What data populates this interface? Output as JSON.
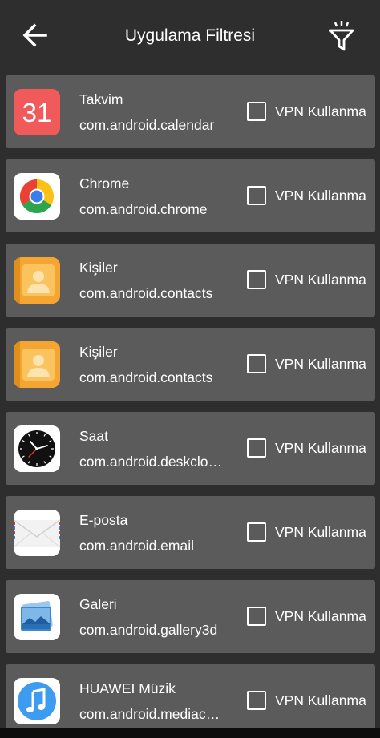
{
  "header": {
    "title": "Uygulama Filtresi",
    "back_icon": "arrow-left-icon",
    "filter_icon": "filter-icon"
  },
  "toggle_label": "VPN Kullanma",
  "apps": [
    {
      "name": "Takvim",
      "package": "com.android.calendar",
      "icon": "calendar-icon",
      "icon_text": "31",
      "checked": false
    },
    {
      "name": "Chrome",
      "package": "com.android.chrome",
      "icon": "chrome-icon",
      "checked": false
    },
    {
      "name": "Kişiler",
      "package": "com.android.contacts",
      "icon": "contacts-icon",
      "checked": false
    },
    {
      "name": "Kişiler",
      "package": "com.android.contacts",
      "icon": "contacts-icon",
      "checked": false
    },
    {
      "name": "Saat",
      "package": "com.android.deskclo…",
      "icon": "clock-icon",
      "checked": false
    },
    {
      "name": "E-posta",
      "package": "com.android.email",
      "icon": "email-icon",
      "checked": false
    },
    {
      "name": "Galeri",
      "package": "com.android.gallery3d",
      "icon": "gallery-icon",
      "checked": false
    },
    {
      "name": "HUAWEI Müzik",
      "package": "com.android.mediac…",
      "icon": "music-icon",
      "checked": false
    }
  ],
  "colors": {
    "background": "#2e2e2e",
    "row": "#5b5b5b",
    "text": "#ffffff"
  }
}
